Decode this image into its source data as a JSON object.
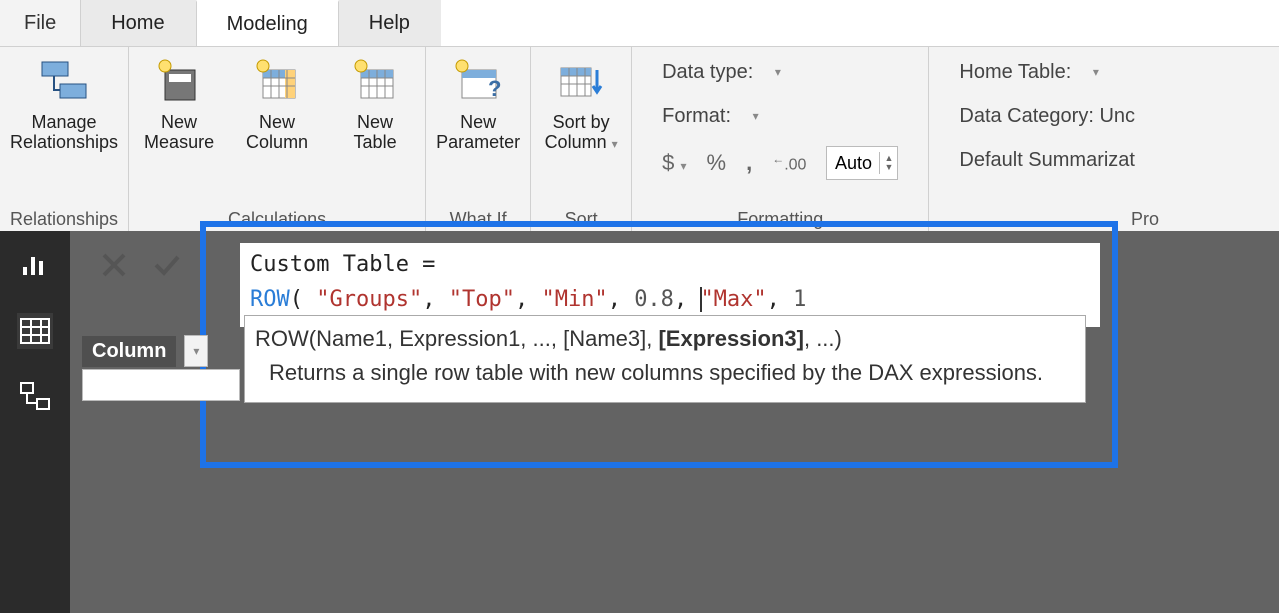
{
  "tabs": {
    "file": "File",
    "home": "Home",
    "modeling": "Modeling",
    "help": "Help"
  },
  "ribbon": {
    "relationships": {
      "manage": "Manage\nRelationships",
      "label": "Relationships"
    },
    "calculations": {
      "newMeasure": "New\nMeasure",
      "newColumn": "New\nColumn",
      "newTable": "New\nTable",
      "label": "Calculations"
    },
    "whatif": {
      "newParameter": "New\nParameter",
      "label": "What If"
    },
    "sort": {
      "sortBy": "Sort by\nColumn",
      "label": "Sort"
    },
    "formatting": {
      "dataType": "Data type:",
      "format": "Format:",
      "dollar": "$",
      "percent": "%",
      "comma": ",",
      "dec": ".00",
      "auto": "Auto",
      "label": "Formatting"
    },
    "props": {
      "homeTable": "Home Table:",
      "dataCategory": "Data Category: Unc",
      "defaultSumm": "Default Summarizat",
      "label": "Pro"
    }
  },
  "field": {
    "label": "Column"
  },
  "formula": {
    "line1_lhs": "Custom Table =",
    "fn": "ROW",
    "p1": "\"Groups\"",
    "p2": "\"Top\"",
    "p3": "\"Min\"",
    "p4": "0.8",
    "p5": "\"Max\"",
    "p6": "1"
  },
  "intelli": {
    "sig_pre": "ROW(Name1, Expression1, ..., [Name3], ",
    "sig_cur": "[Expression3]",
    "sig_post": ", ...)",
    "desc": "Returns a single row table with new columns specified by the DAX expressions."
  }
}
